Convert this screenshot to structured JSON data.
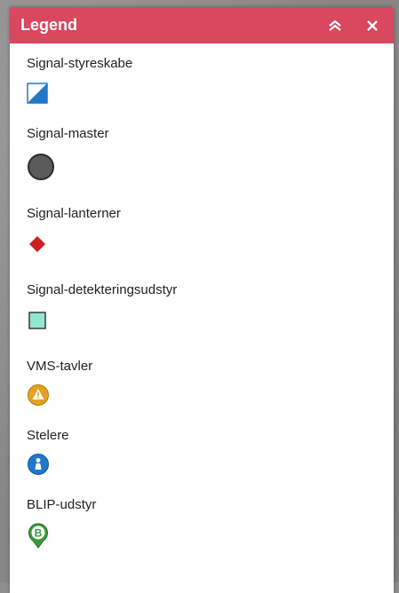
{
  "legend": {
    "title": "Legend",
    "colors": {
      "header": "#d9485f"
    },
    "items": [
      {
        "label": "Signal-styreskabe",
        "symbol": "half-triangle-square-icon",
        "color": "#1f78c8"
      },
      {
        "label": "Signal-master",
        "symbol": "dark-circle-icon",
        "color": "#555555"
      },
      {
        "label": "Signal-lanterner",
        "symbol": "red-diamond-icon",
        "color": "#cc1f1f"
      },
      {
        "label": "Signal-detekteringsudstyr",
        "symbol": "teal-square-icon",
        "color": "#8fe8cf"
      },
      {
        "label": "VMS-tavler",
        "symbol": "warning-circle-icon",
        "color": "#e2a224"
      },
      {
        "label": "Stelere",
        "symbol": "person-circle-icon",
        "color": "#1f78c8"
      },
      {
        "label": "BLIP-udstyr",
        "symbol": "b-pin-icon",
        "color": "#3a9a3a"
      }
    ]
  }
}
